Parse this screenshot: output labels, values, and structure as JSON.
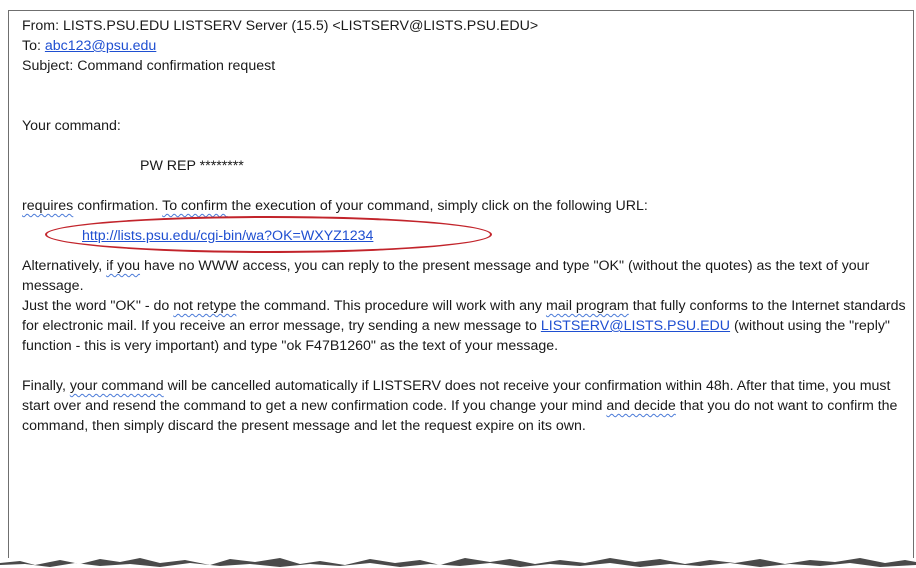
{
  "header": {
    "from_label": "From:",
    "from_value": "LISTS.PSU.EDU LISTSERV Server (15.5) <LISTSERV@LISTS.PSU.EDU>",
    "to_label": "To:",
    "to_value": "abc123@psu.edu",
    "subject_label": "Subject:",
    "subject_value": "Command confirmation request"
  },
  "body": {
    "intro": "Your command:",
    "command": "PW REP ********",
    "confirm_p1": "requires",
    "confirm_p2": " confirmation. ",
    "confirm_p3": "To  confirm",
    "confirm_p4": " the execution of  your command, simply click on the following URL:",
    "confirm_url": "http://lists.psu.edu/cgi-bin/wa?OK=WXYZ1234",
    "alt_1": "Alternatively, ",
    "alt_2": "if  you",
    "alt_3": " have no WWW  access, you can reply  to the present message and type  \"OK\" (without the quotes) as the  text of your message.",
    "alt_4": "Just the word \"OK\" - do ",
    "alt_5": "not  retype",
    "alt_6": " the command. This procedure will work with any ",
    "alt_7": "mail  program",
    "alt_8": " that fully conforms to the  Internet standards for electronic  mail. If  you receive  an error  message, try  sending  a  new message to ",
    "alt_link": "LISTSERV@LISTS.PSU.EDU",
    "alt_9": " (without using the  \"reply\" function - this  is very  important) and  type  \"ok F47B1260\"  as the text of  your message.",
    "fin_1": "Finally, ",
    "fin_2": "your  command",
    "fin_3": " will be  cancelled automatically if  LISTSERV does not receive your confirmation within 48h. After that time, you must start over and resend the command to get a new confirmation code. If you change your mind ",
    "fin_4": "and decide",
    "fin_5": " that you do  not want to confirm  the command, then simply discard the present message and let the request expire on its own."
  }
}
